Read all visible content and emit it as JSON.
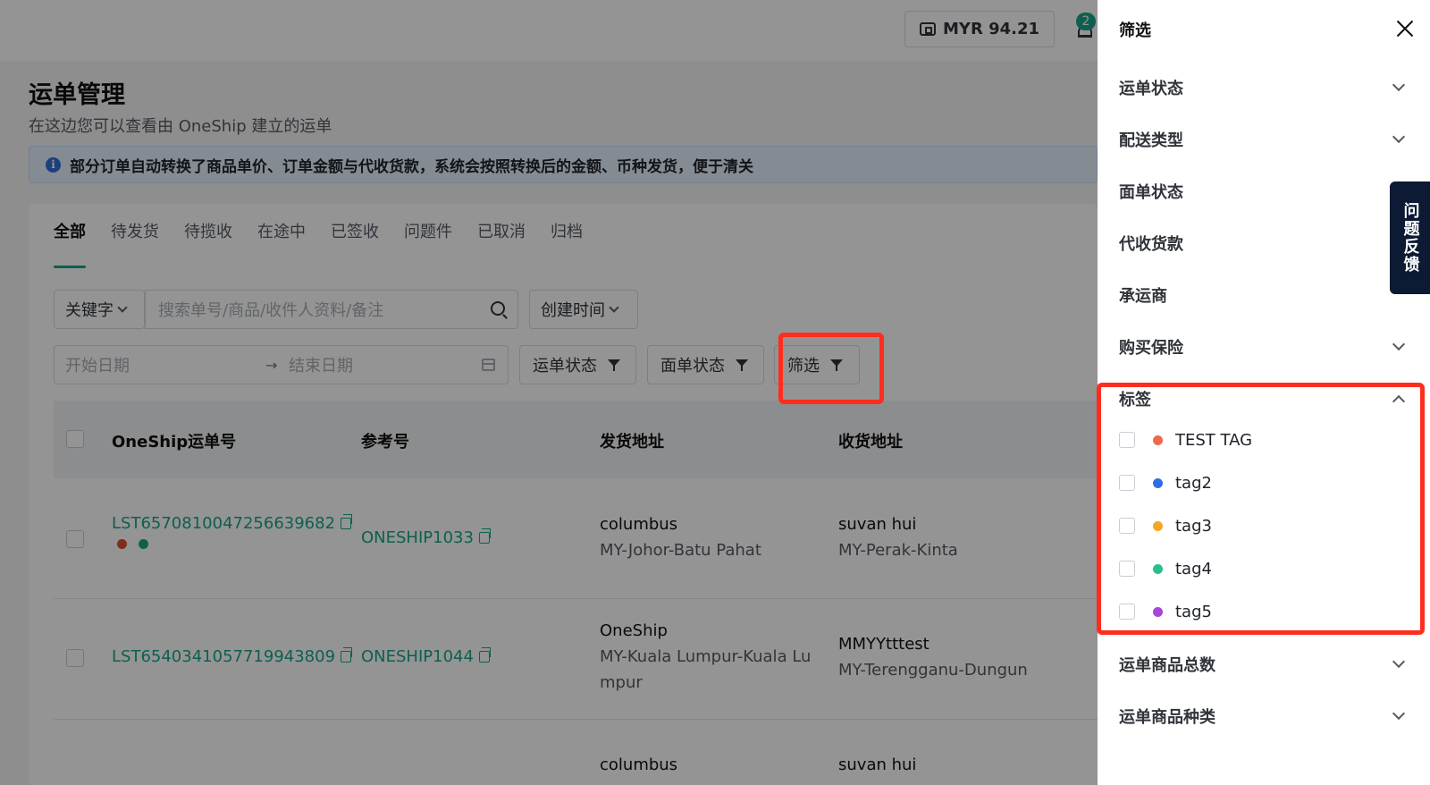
{
  "header": {
    "balance": "MYR 94.21",
    "notification_count": "2"
  },
  "page": {
    "title": "运单管理",
    "subtitle": "在这边您可以查看由 OneShip 建立的运单",
    "notice": "部分订单自动转换了商品单价、订单金额与代收货款，系统会按照转换后的金额、币种发货，便于清关"
  },
  "tabs": [
    "全部",
    "待发货",
    "待揽收",
    "在途中",
    "已签收",
    "问题件",
    "已取消",
    "归档"
  ],
  "filters": {
    "keyword_select": "关键字",
    "search_placeholder": "搜索单号/商品/收件人资料/备注",
    "time_select": "创建时间",
    "start_date_placeholder": "开始日期",
    "date_arrow": "→",
    "end_date_placeholder": "结束日期",
    "waybill_status": "运单状态",
    "label_status": "面单状态",
    "filter_button": "筛选"
  },
  "table": {
    "columns": [
      "OneShip运单号",
      "参考号",
      "发货地址",
      "收货地址"
    ],
    "rows": [
      {
        "waybill": "LST6570810047256639682",
        "ref": "ONESHIP1033",
        "sender_name": "columbus",
        "sender_addr": "MY-Johor-Batu Pahat",
        "receiver_name": "suvan hui",
        "receiver_addr": "MY-Perak-Kinta",
        "tag_colors": [
          "#d9502e",
          "#17a589"
        ]
      },
      {
        "waybill": "LST6540341057719943809",
        "ref": "ONESHIP1044",
        "sender_name": "OneShip",
        "sender_addr_line1": "MY-Kuala Lumpur-Kuala Lu",
        "sender_addr_line2": "mpur",
        "receiver_name": "MMYYtttest",
        "receiver_addr": "MY-Terengganu-Dungun"
      },
      {
        "sender_name": "columbus",
        "receiver_name": "suvan hui"
      }
    ]
  },
  "drawer": {
    "title": "筛选",
    "sections": [
      "运单状态",
      "配送类型",
      "面单状态",
      "代收货款",
      "承运商",
      "购买保险"
    ],
    "tag_section": {
      "title": "标签",
      "items": [
        {
          "label": "TEST TAG",
          "color": "#f06a4a"
        },
        {
          "label": "tag2",
          "color": "#2f6fe6"
        },
        {
          "label": "tag3",
          "color": "#f5a623"
        },
        {
          "label": "tag4",
          "color": "#2bbf8f"
        },
        {
          "label": "tag5",
          "color": "#a746d9"
        }
      ]
    },
    "bottom_sections": [
      "运单商品总数",
      "运单商品种类"
    ]
  },
  "feedback_button": "问题反馈",
  "colors": {
    "accent": "#17a589",
    "highlight": "#ff2d1e",
    "overlay": "rgba(0,0,0,0.42)"
  }
}
